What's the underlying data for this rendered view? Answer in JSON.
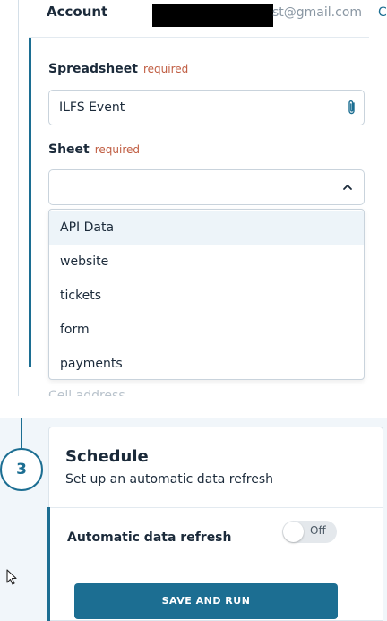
{
  "account": {
    "label": "Account",
    "email_visible": "st@gmail.com",
    "change_link": "Cha"
  },
  "spreadsheet": {
    "label": "Spreadsheet",
    "required": "required",
    "value": "ILFS Event",
    "icon": "paperclip-icon"
  },
  "sheet": {
    "label": "Sheet",
    "required": "required",
    "value": "",
    "icon": "chevron-up-icon",
    "options": [
      "API Data",
      "website",
      "tickets",
      "form",
      "payments"
    ],
    "highlighted": "API Data"
  },
  "faded_row": {
    "label": "Cell address"
  },
  "schedule": {
    "step_number": "3",
    "title": "Schedule",
    "subtitle": "Set up an automatic data refresh",
    "auto_refresh_label": "Automatic data refresh",
    "toggle_state": "Off",
    "save_button": "SAVE AND RUN"
  },
  "colors": {
    "accent": "#1c6e92",
    "required": "#c05d42",
    "highlight_row": "#edf4f9"
  }
}
